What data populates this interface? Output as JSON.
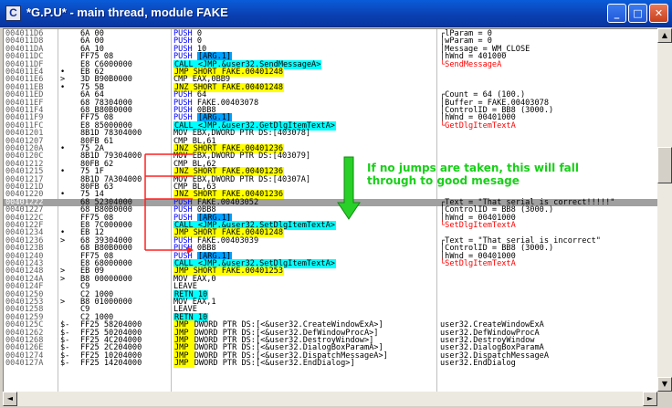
{
  "window": {
    "title": "*G.P.U* - main thread, module FAKE",
    "icon_letter": "C",
    "buttons": {
      "minimize": "_",
      "maximize": "□",
      "close": "✕"
    }
  },
  "colors": {
    "call": "#00ffff",
    "jmp": "#ffff00",
    "arg": "#00a0ff",
    "push": "#0000ff",
    "retn": "#00ffff",
    "api": "#ff0000",
    "annotation": "#18d018",
    "arrow": "#ff0000"
  },
  "annotation": {
    "line1": "If no jumps are taken, this will fall",
    "line2": "through to good mesage"
  },
  "rows": [
    {
      "addr": "004011D6",
      "jmp": "",
      "hex": "6A 00",
      "segs": [
        {
          "t": "PUSH ",
          "c": "push"
        },
        {
          "t": "0",
          "c": "n"
        }
      ],
      "cmt": "┌lParam = 0"
    },
    {
      "addr": "004011D8",
      "jmp": "",
      "hex": "6A 00",
      "segs": [
        {
          "t": "PUSH ",
          "c": "push"
        },
        {
          "t": "0",
          "c": "n"
        }
      ],
      "cmt": "│wParam = 0"
    },
    {
      "addr": "004011DA",
      "jmp": "",
      "hex": "6A 10",
      "segs": [
        {
          "t": "PUSH ",
          "c": "push"
        },
        {
          "t": "10",
          "c": "n"
        }
      ],
      "cmt": "│Message = WM_CLOSE"
    },
    {
      "addr": "004011DC",
      "jmp": "",
      "hex": "FF75 08",
      "segs": [
        {
          "t": "PUSH ",
          "c": "push"
        },
        {
          "t": "[ARG.1]",
          "c": "arg"
        }
      ],
      "cmt": "│hWnd = 401000"
    },
    {
      "addr": "004011DF",
      "jmp": "",
      "hex": "E8 C6000000",
      "segs": [
        {
          "t": "CALL <JMP.&user32.SendMessageA>",
          "c": "call"
        }
      ],
      "cmt": "└SendMessageA",
      "cc": "api"
    },
    {
      "addr": "004011E4",
      "jmp": "•",
      "hex": "EB 62",
      "segs": [
        {
          "t": "JMP SHORT FAKE.00401248",
          "c": "jmp"
        }
      ],
      "cmt": ""
    },
    {
      "addr": "004011E6",
      "jmp": ">",
      "hex": "3D B90B0000",
      "segs": [
        {
          "t": "CMP EAX,0BB9",
          "c": "n"
        }
      ],
      "cmt": ""
    },
    {
      "addr": "004011EB",
      "jmp": "•",
      "hex": "75 5B",
      "segs": [
        {
          "t": "JNZ SHORT FAKE.00401248",
          "c": "jmp"
        }
      ],
      "cmt": ""
    },
    {
      "addr": "004011ED",
      "jmp": "",
      "hex": "6A 64",
      "segs": [
        {
          "t": "PUSH ",
          "c": "push"
        },
        {
          "t": "64",
          "c": "n"
        }
      ],
      "cmt": "┌Count = 64 (100.)"
    },
    {
      "addr": "004011EF",
      "jmp": "",
      "hex": "68 78304000",
      "segs": [
        {
          "t": "PUSH ",
          "c": "push"
        },
        {
          "t": "FAKE.00403078",
          "c": "n"
        }
      ],
      "cmt": "│Buffer = FAKE.00403078"
    },
    {
      "addr": "004011F4",
      "jmp": "",
      "hex": "68 B80B0000",
      "segs": [
        {
          "t": "PUSH ",
          "c": "push"
        },
        {
          "t": "0BB8",
          "c": "n"
        }
      ],
      "cmt": "│ControlID = BB8 (3000.)"
    },
    {
      "addr": "004011F9",
      "jmp": "",
      "hex": "FF75 08",
      "segs": [
        {
          "t": "PUSH ",
          "c": "push"
        },
        {
          "t": "[ARG.1]",
          "c": "arg"
        }
      ],
      "cmt": "│hWnd = 00401000"
    },
    {
      "addr": "004011FC",
      "jmp": "",
      "hex": "E8 85000000",
      "segs": [
        {
          "t": "CALL <JMP.&user32.GetDlgItemTextA>",
          "c": "call"
        }
      ],
      "cmt": "└GetDlgItemTextA",
      "cc": "api"
    },
    {
      "addr": "00401201",
      "jmp": "",
      "hex": "8B1D 78304000",
      "segs": [
        {
          "t": "MOV EBX,DWORD PTR DS:[403078]",
          "c": "n"
        }
      ],
      "cmt": ""
    },
    {
      "addr": "00401207",
      "jmp": "",
      "hex": "80FB 61",
      "segs": [
        {
          "t": "CMP BL,61",
          "c": "n"
        }
      ],
      "cmt": ""
    },
    {
      "addr": "0040120A",
      "jmp": "•",
      "hex": "75 2A",
      "segs": [
        {
          "t": "JNZ SHORT FAKE.00401236",
          "c": "jmp"
        }
      ],
      "cmt": ""
    },
    {
      "addr": "0040120C",
      "jmp": "",
      "hex": "8B1D 79304000",
      "segs": [
        {
          "t": "MOV EBX,DWORD PTR DS:[403079]",
          "c": "n"
        }
      ],
      "cmt": ""
    },
    {
      "addr": "00401212",
      "jmp": "",
      "hex": "80FB 62",
      "segs": [
        {
          "t": "CMP BL,62",
          "c": "n"
        }
      ],
      "cmt": ""
    },
    {
      "addr": "00401215",
      "jmp": "•",
      "hex": "75 1F",
      "segs": [
        {
          "t": "JNZ SHORT FAKE.00401236",
          "c": "jmp"
        }
      ],
      "cmt": ""
    },
    {
      "addr": "00401217",
      "jmp": "",
      "hex": "8B1D 7A304000",
      "segs": [
        {
          "t": "MOV EBX,DWORD PTR DS:[40307A]",
          "c": "n"
        }
      ],
      "cmt": ""
    },
    {
      "addr": "0040121D",
      "jmp": "",
      "hex": "80FB 63",
      "segs": [
        {
          "t": "CMP BL,63",
          "c": "n"
        }
      ],
      "cmt": ""
    },
    {
      "addr": "00401220",
      "jmp": "•",
      "hex": "75 14",
      "segs": [
        {
          "t": "JNZ SHORT FAKE.00401236",
          "c": "jmp"
        }
      ],
      "cmt": ""
    },
    {
      "addr": "00401222",
      "jmp": "",
      "hex": "68 52304000",
      "segs": [
        {
          "t": "PUSH ",
          "c": "push"
        },
        {
          "t": "FAKE.00403052",
          "c": "n"
        }
      ],
      "cmt": "┌Text = \"That serial is correct!!!!!\"",
      "sel": true
    },
    {
      "addr": "00401227",
      "jmp": "",
      "hex": "68 B80B0000",
      "segs": [
        {
          "t": "PUSH ",
          "c": "push"
        },
        {
          "t": "0BB8",
          "c": "n"
        }
      ],
      "cmt": "│ControlID = BB8 (3000.)"
    },
    {
      "addr": "0040122C",
      "jmp": "",
      "hex": "FF75 08",
      "segs": [
        {
          "t": "PUSH ",
          "c": "push"
        },
        {
          "t": "[ARG.1]",
          "c": "arg"
        }
      ],
      "cmt": "│hWnd = 00401000"
    },
    {
      "addr": "0040122F",
      "jmp": "",
      "hex": "E8 7C000000",
      "segs": [
        {
          "t": "CALL <JMP.&user32.SetDlgItemTextA>",
          "c": "call"
        }
      ],
      "cmt": "└SetDlgItemTextA",
      "cc": "api"
    },
    {
      "addr": "00401234",
      "jmp": "•",
      "hex": "EB 12",
      "segs": [
        {
          "t": "JMP SHORT FAKE.00401248",
          "c": "jmp"
        }
      ],
      "cmt": ""
    },
    {
      "addr": "00401236",
      "jmp": ">",
      "hex": "68 39304000",
      "segs": [
        {
          "t": "PUSH ",
          "c": "push"
        },
        {
          "t": "FAKE.00403039",
          "c": "n"
        }
      ],
      "cmt": "┌Text = \"That serial is incorrect\""
    },
    {
      "addr": "0040123B",
      "jmp": "",
      "hex": "68 B80B0000",
      "segs": [
        {
          "t": "PUSH ",
          "c": "push"
        },
        {
          "t": "0BB8",
          "c": "n"
        }
      ],
      "cmt": "│ControlID = BB8 (3000.)"
    },
    {
      "addr": "00401240",
      "jmp": "",
      "hex": "FF75 08",
      "segs": [
        {
          "t": "PUSH ",
          "c": "push"
        },
        {
          "t": "[ARG.1]",
          "c": "arg"
        }
      ],
      "cmt": "│hWnd = 00401000"
    },
    {
      "addr": "00401243",
      "jmp": "",
      "hex": "E8 68000000",
      "segs": [
        {
          "t": "CALL <JMP.&user32.SetDlgItemTextA>",
          "c": "call"
        }
      ],
      "cmt": "└SetDlgItemTextA",
      "cc": "api"
    },
    {
      "addr": "00401248",
      "jmp": ">",
      "hex": "EB 09",
      "segs": [
        {
          "t": "JMP SHORT FAKE.00401253",
          "c": "jmp"
        }
      ],
      "cmt": ""
    },
    {
      "addr": "0040124A",
      "jmp": ">",
      "hex": "B8 00000000",
      "segs": [
        {
          "t": "MOV EAX,0",
          "c": "n"
        }
      ],
      "cmt": ""
    },
    {
      "addr": "0040124F",
      "jmp": "",
      "hex": "C9",
      "segs": [
        {
          "t": "LEAVE",
          "c": "n"
        }
      ],
      "cmt": ""
    },
    {
      "addr": "00401250",
      "jmp": "",
      "hex": "C2 1000",
      "segs": [
        {
          "t": "RETN 10",
          "c": "retn"
        }
      ],
      "cmt": ""
    },
    {
      "addr": "00401253",
      "jmp": ">",
      "hex": "B8 01000000",
      "segs": [
        {
          "t": "MOV EAX,1",
          "c": "n"
        }
      ],
      "cmt": ""
    },
    {
      "addr": "00401258",
      "jmp": "",
      "hex": "C9",
      "segs": [
        {
          "t": "LEAVE",
          "c": "n"
        }
      ],
      "cmt": ""
    },
    {
      "addr": "00401259",
      "jmp": "",
      "hex": "C2 1000",
      "segs": [
        {
          "t": "RETN 10",
          "c": "retn"
        }
      ],
      "cmt": ""
    },
    {
      "addr": "0040125C",
      "jmp": "$-",
      "hex": "FF25 58204000",
      "segs": [
        {
          "t": "JMP ",
          "c": "jmpk"
        },
        {
          "t": "DWORD PTR DS:[<&user32.CreateWindowExA>]",
          "c": "n"
        }
      ],
      "cmt": "user32.CreateWindowExA"
    },
    {
      "addr": "00401262",
      "jmp": "$-",
      "hex": "FF25 50204000",
      "segs": [
        {
          "t": "JMP ",
          "c": "jmpk"
        },
        {
          "t": "DWORD PTR DS:[<&user32.DefWindowProcA>]",
          "c": "n"
        }
      ],
      "cmt": "user32.DefWindowProcA"
    },
    {
      "addr": "00401268",
      "jmp": "$-",
      "hex": "FF25 4C204000",
      "segs": [
        {
          "t": "JMP ",
          "c": "jmpk"
        },
        {
          "t": "DWORD PTR DS:[<&user32.DestroyWindow>]",
          "c": "n"
        }
      ],
      "cmt": "user32.DestroyWindow"
    },
    {
      "addr": "0040126E",
      "jmp": "$-",
      "hex": "FF25 2C204000",
      "segs": [
        {
          "t": "JMP ",
          "c": "jmpk"
        },
        {
          "t": "DWORD PTR DS:[<&user32.DialogBoxParamA>]",
          "c": "n"
        }
      ],
      "cmt": "user32.DialogBoxParamA"
    },
    {
      "addr": "00401274",
      "jmp": "$-",
      "hex": "FF25 10204000",
      "segs": [
        {
          "t": "JMP ",
          "c": "jmpk"
        },
        {
          "t": "DWORD PTR DS:[<&user32.DispatchMessageA>]",
          "c": "n"
        }
      ],
      "cmt": "user32.DispatchMessageA"
    },
    {
      "addr": "0040127A",
      "jmp": "$-",
      "hex": "FF25 14204000",
      "segs": [
        {
          "t": "JMP ",
          "c": "jmpk"
        },
        {
          "t": "DWORD PTR DS:[<&user32.EndDialog>]",
          "c": "n"
        }
      ],
      "cmt": "user32.EndDialog"
    }
  ]
}
